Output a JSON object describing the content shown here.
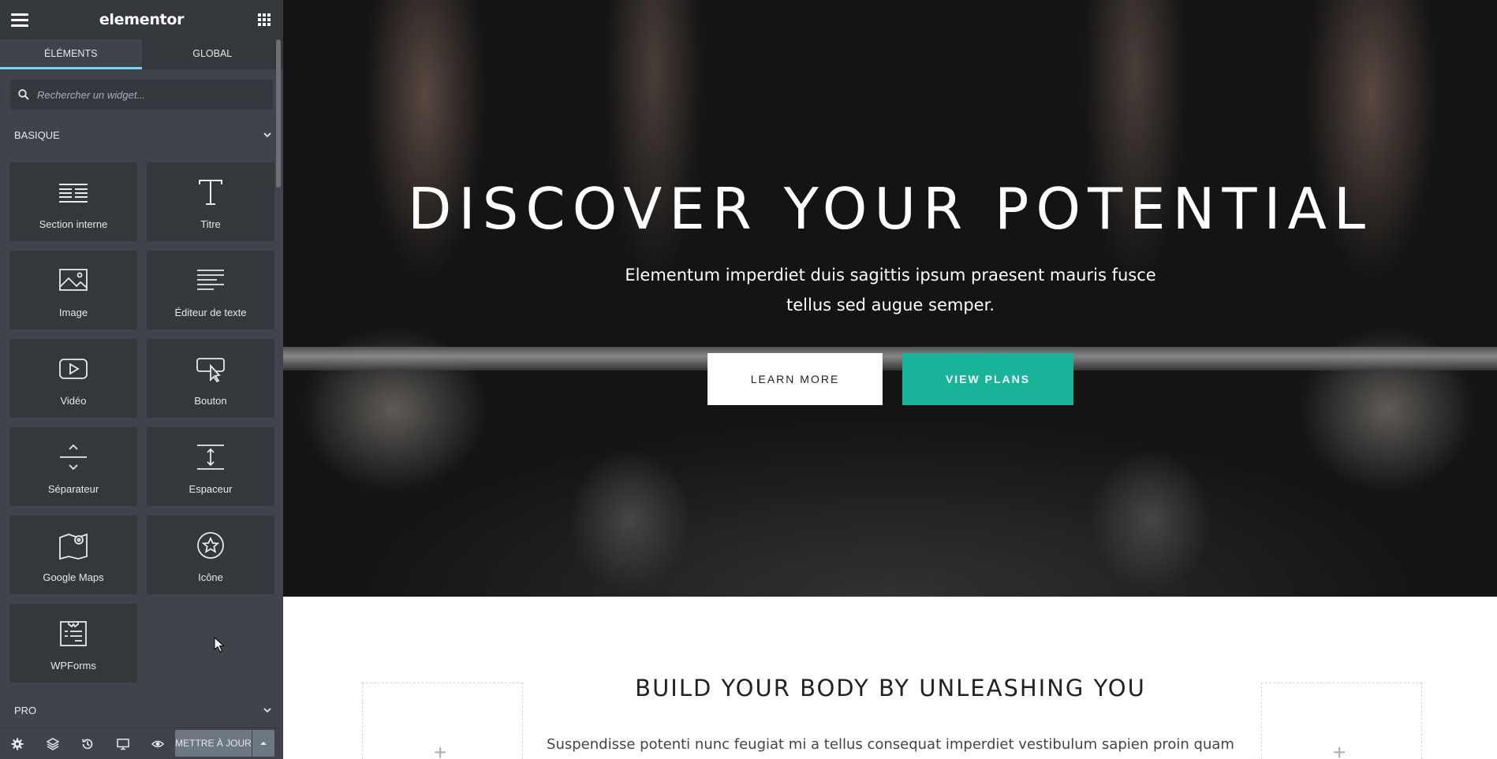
{
  "app": {
    "logo": "elementor"
  },
  "tabs": [
    {
      "label": "ÉLÉMENTS"
    },
    {
      "label": "GLOBAL"
    }
  ],
  "search": {
    "placeholder": "Rechercher un widget..."
  },
  "categories": {
    "basic": "BASIQUE",
    "pro": "PRO"
  },
  "widgets": [
    {
      "label": "Section interne",
      "icon": "inner-section-icon"
    },
    {
      "label": "Titre",
      "icon": "heading-icon"
    },
    {
      "label": "Image",
      "icon": "image-icon"
    },
    {
      "label": "Éditeur de texte",
      "icon": "text-editor-icon"
    },
    {
      "label": "Vidéo",
      "icon": "video-icon"
    },
    {
      "label": "Bouton",
      "icon": "button-icon"
    },
    {
      "label": "Séparateur",
      "icon": "divider-icon"
    },
    {
      "label": "Espaceur",
      "icon": "spacer-icon"
    },
    {
      "label": "Google Maps",
      "icon": "map-icon"
    },
    {
      "label": "Icône",
      "icon": "star-icon"
    },
    {
      "label": "WPForms",
      "icon": "wpforms-icon"
    }
  ],
  "footer": {
    "update_label": "METTRE À JOUR"
  },
  "hero": {
    "title": "DISCOVER YOUR POTENTIAL",
    "subtitle": "Elementum imperdiet duis sagittis ipsum praesent mauris fusce tellus sed augue semper.",
    "learn_more": "LEARN MORE",
    "view_plans": "VIEW PLANS"
  },
  "section": {
    "title": "BUILD YOUR BODY BY UNLEASHING YOU",
    "text": "Suspendisse potenti nunc feugiat mi a tellus consequat imperdiet vestibulum sapien proin quam"
  },
  "colors": {
    "panel": "#404349",
    "panel_dark": "#34383c",
    "accent_tab": "#71d7f7",
    "brand_teal": "#19b39a"
  }
}
